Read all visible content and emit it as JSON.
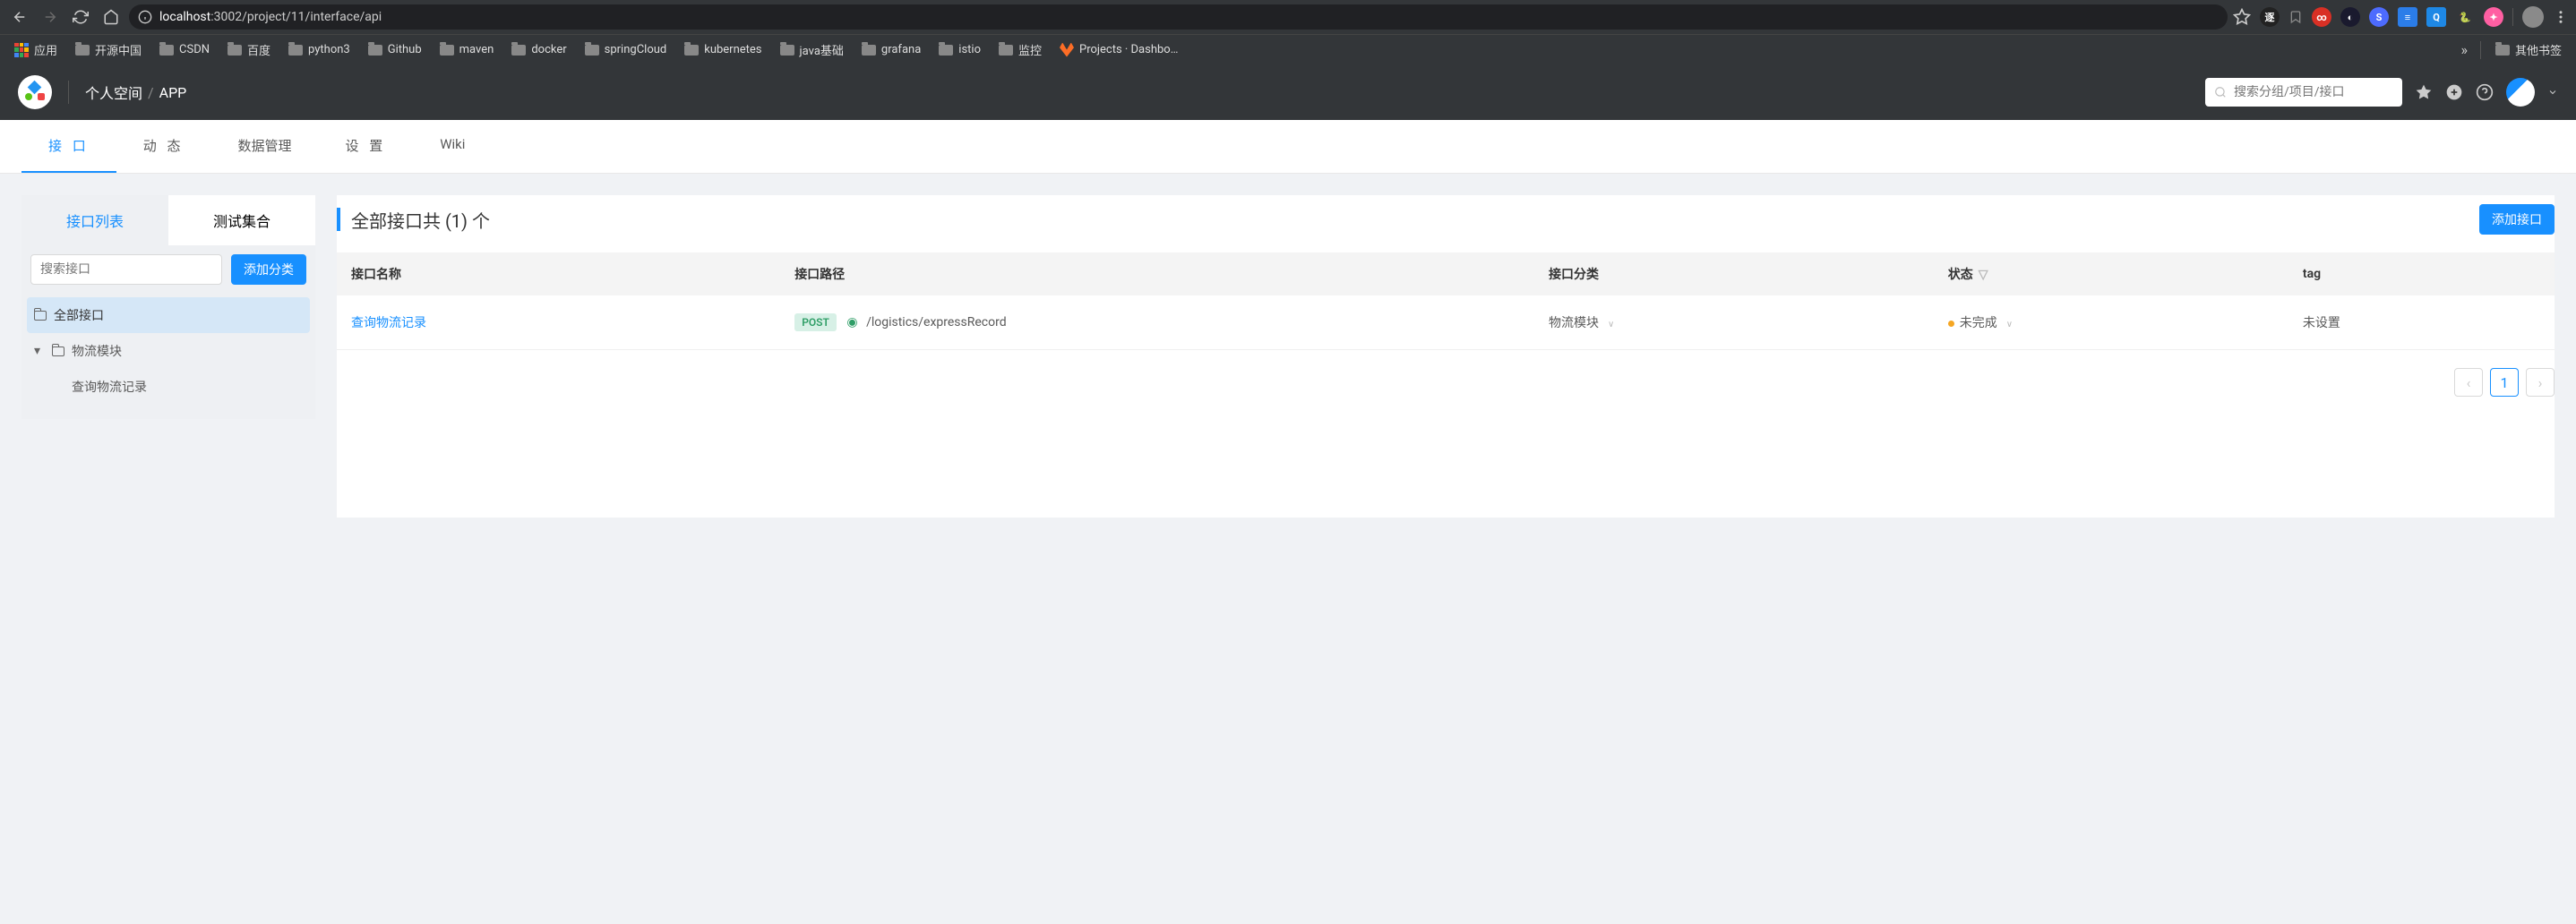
{
  "browser": {
    "url_host": "localhost",
    "url_rest": ":3002/project/11/interface/api"
  },
  "bookmarks": {
    "apps": "应用",
    "items": [
      "开源中国",
      "CSDN",
      "百度",
      "python3",
      "Github",
      "maven",
      "docker",
      "springCloud",
      "kubernetes",
      "java基础",
      "grafana",
      "istio",
      "监控"
    ],
    "gitlab": "Projects · Dashbo…",
    "more": "»",
    "others": "其他书签"
  },
  "header": {
    "breadcrumb": {
      "space": "个人空间",
      "project": "APP"
    },
    "search_placeholder": "搜索分组/项目/接口"
  },
  "tabs": {
    "items": [
      {
        "label": "接 口",
        "active": true
      },
      {
        "label": "动 态"
      },
      {
        "label": "数据管理"
      },
      {
        "label": "设 置"
      },
      {
        "label": "Wiki",
        "nospacing": true
      }
    ]
  },
  "sidebar": {
    "tabs": {
      "list": "接口列表",
      "tests": "测试集合"
    },
    "search_placeholder": "搜索接口",
    "add_category": "添加分类",
    "tree": {
      "all": "全部接口",
      "module": "物流模块",
      "leaf": "查询物流记录"
    }
  },
  "main": {
    "title": "全部接口共 (1) 个",
    "add_btn": "添加接口",
    "columns": {
      "name": "接口名称",
      "path": "接口路径",
      "category": "接口分类",
      "status": "状态",
      "tag": "tag"
    },
    "rows": [
      {
        "name": "查询物流记录",
        "method": "POST",
        "path": "/logistics/expressRecord",
        "category": "物流模块",
        "status_color": "#f5a623",
        "status": "未完成",
        "tag": "未设置"
      }
    ],
    "pagination": {
      "current": "1"
    }
  }
}
